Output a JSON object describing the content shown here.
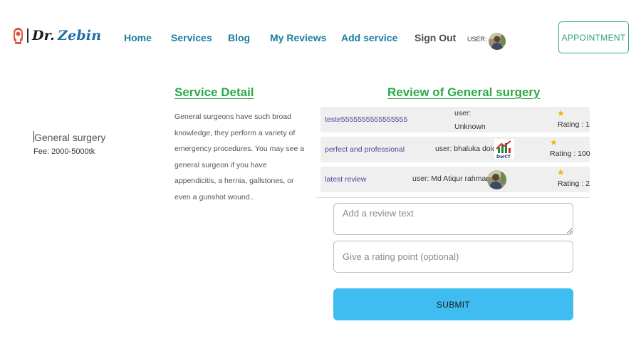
{
  "brand": {
    "prefix": "Dr.",
    "name": "Zebin"
  },
  "nav": {
    "links": [
      "Home",
      "Services",
      "Blog",
      "My Reviews",
      "Add service",
      "Sign Out"
    ],
    "user_label": "USER:",
    "appointment_label": "APPOINTMENT"
  },
  "service": {
    "name": "General surgery",
    "fee": "Fee: 2000-5000tk"
  },
  "detail": {
    "title": "Service Detail",
    "text": "General surgeons have such broad knowledge, they perform a variety of emergency procedures. You may see a general surgeon if you have appendicitis, a hernia, gallstones, or even a gunshot wound.."
  },
  "reviews": {
    "title": "Review of General surgery",
    "items": [
      {
        "text": "teste5555555555555555",
        "user_line1": "user:",
        "user_line2": "Unknown",
        "rating": "Rating : 1"
      },
      {
        "text": "perfect and professional",
        "user_line1": "user: bhaluka doict",
        "rating": "Rating : 100"
      },
      {
        "text": "latest review",
        "user_line1": "user: Md Atiqur rahman",
        "rating": "Rating : 2"
      }
    ]
  },
  "form": {
    "review_placeholder": "Add a review text",
    "rating_placeholder": "Give a rating point (optional)",
    "submit_label": "SUBMIT"
  },
  "colors": {
    "nav_link": "#1a7fa0",
    "heading": "#2ea84a",
    "submit_bg": "#3fbcf0",
    "appointment_border": "#3aa58a",
    "review_text": "#5c3d9a"
  }
}
